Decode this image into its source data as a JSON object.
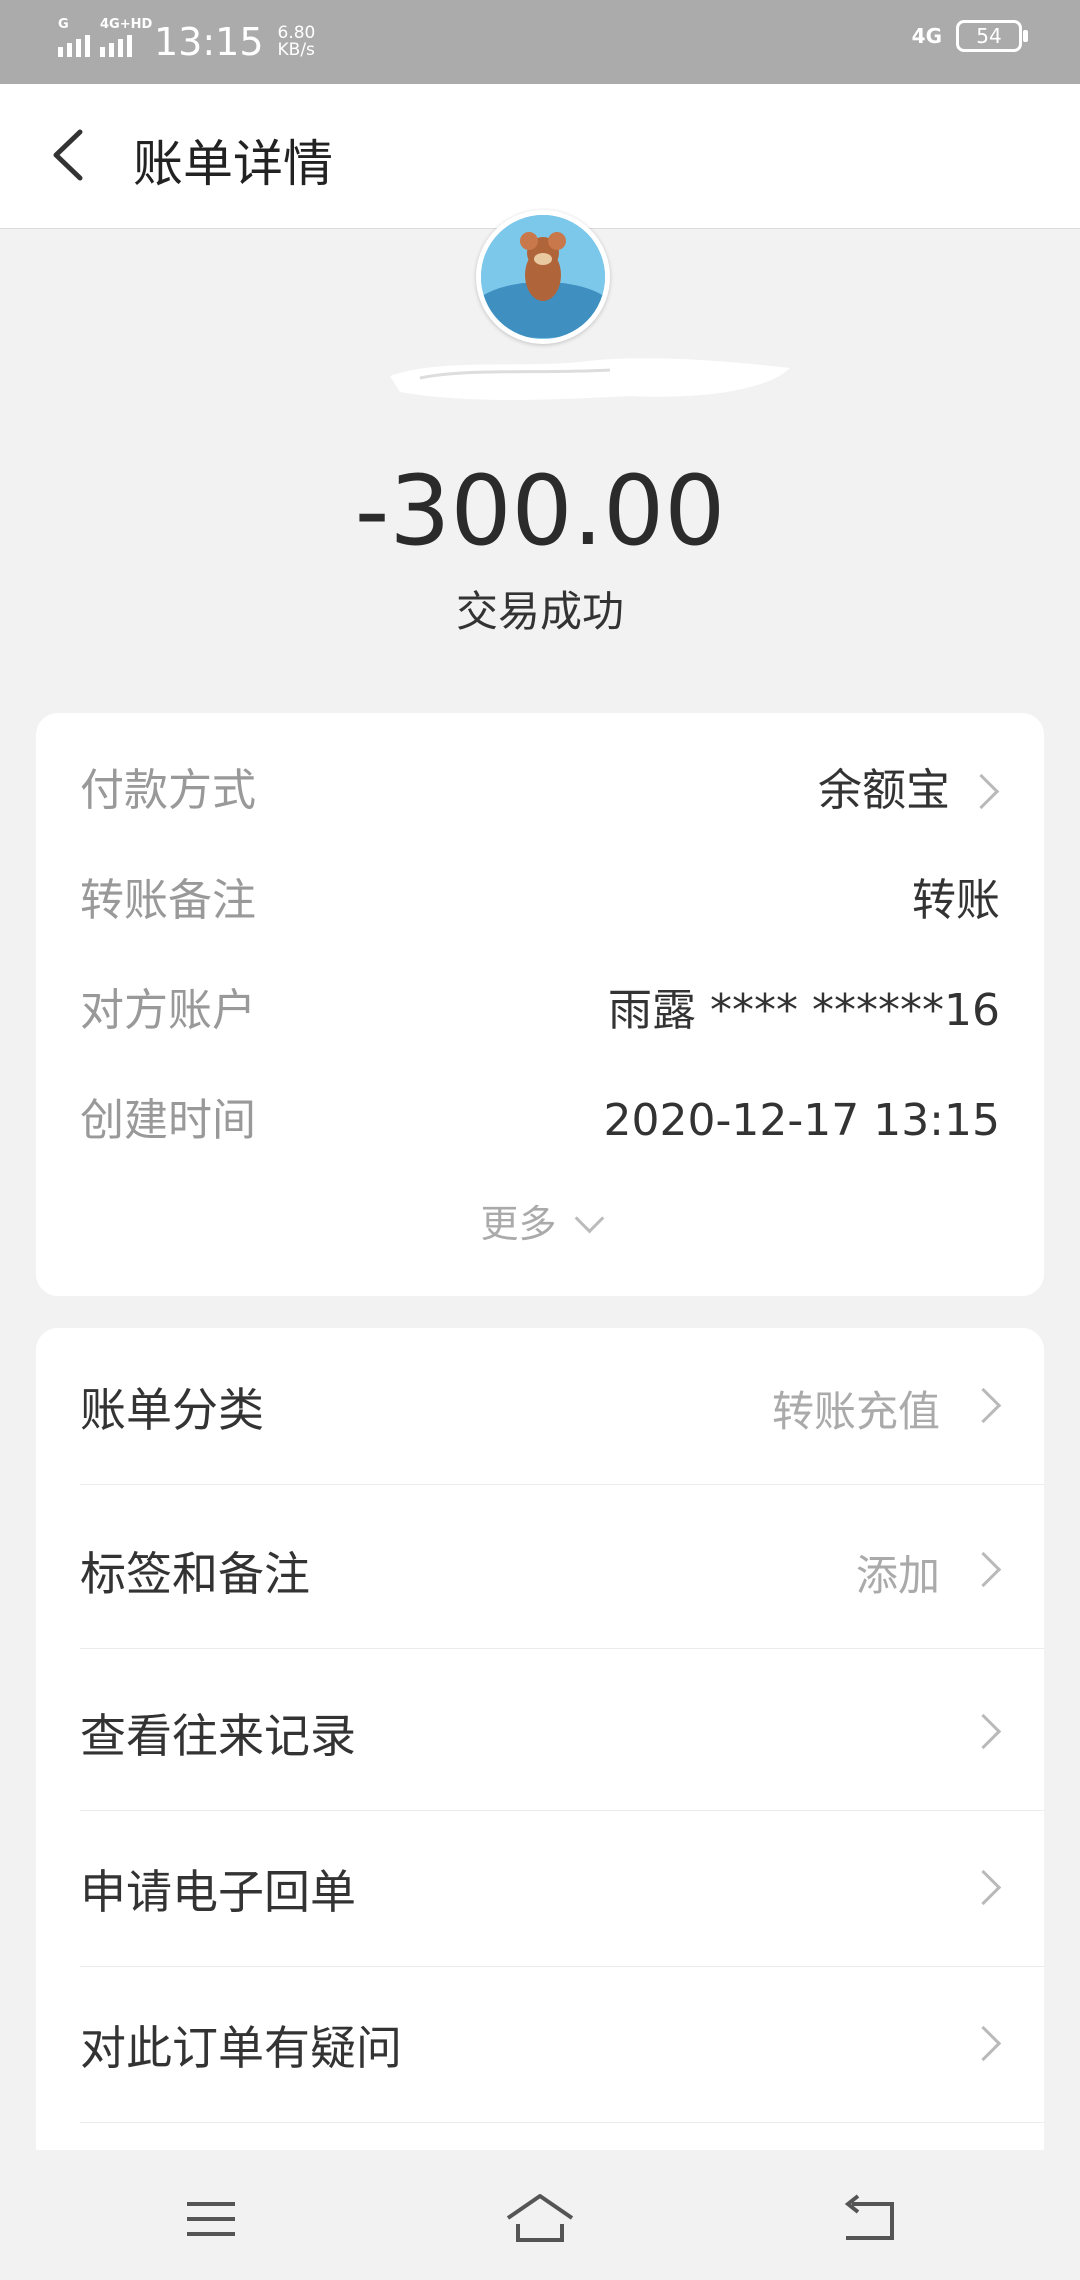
{
  "status_bar": {
    "signal1_tag": "G",
    "signal2_tag": "4G+HD",
    "time": "13:15",
    "speed_value": "6.80",
    "speed_unit": "KB/s",
    "network": "4G",
    "battery": "54"
  },
  "header": {
    "title": "账单详情"
  },
  "summary": {
    "amount": "-300.00",
    "status": "交易成功"
  },
  "details": {
    "rows": [
      {
        "label": "付款方式",
        "value": "余额宝"
      },
      {
        "label": "转账备注",
        "value": "转账"
      },
      {
        "label": "对方账户",
        "value": "雨露 **** ******16"
      },
      {
        "label": "创建时间",
        "value": "2020-12-17 13:15"
      }
    ],
    "more_label": "更多"
  },
  "menu": {
    "items": [
      {
        "label": "账单分类",
        "value": "转账充值"
      },
      {
        "label": "标签和备注",
        "value": "添加"
      },
      {
        "label": "查看往来记录",
        "value": ""
      },
      {
        "label": "申请电子回单",
        "value": ""
      },
      {
        "label": "对此订单有疑问",
        "value": ""
      }
    ]
  },
  "colors": {
    "status_bar": "#ababab",
    "background": "#f2f2f2",
    "card": "#ffffff",
    "primary_text": "#333333",
    "secondary_text": "#999999"
  }
}
